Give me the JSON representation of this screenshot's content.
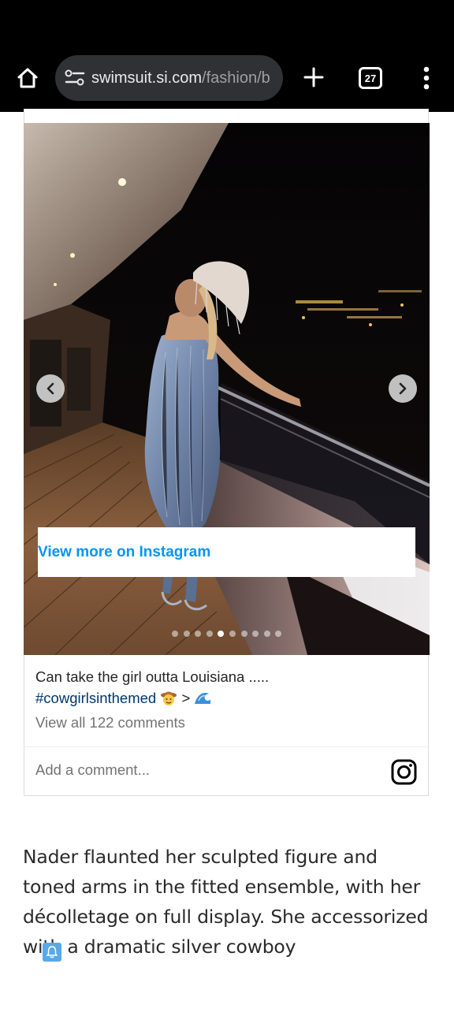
{
  "browser": {
    "url_host": "swimsuit.si.com",
    "url_path": "/fashion/b",
    "tab_count": "27",
    "home_icon": "home-icon",
    "site_settings_icon": "tune-icon",
    "new_tab_icon": "plus-icon",
    "menu_icon": "more-vert-icon"
  },
  "instagram": {
    "view_more": "View more on Instagram",
    "caption_text": "Can take the girl outta Louisiana .....",
    "hashtag": "#cowgirlsinthemed",
    "caption_arrow": ">",
    "view_comments": "View all 122 comments",
    "comment_placeholder": "Add a comment...",
    "carousel": {
      "total": 10,
      "active": 5
    },
    "accent_color": "#0095f6"
  },
  "article": {
    "paragraph": "Nader flaunted her sculpted figure and toned arms in the fitted ensemble, with her décolletage on full display. She accessorized with a dramatic silver cowboy"
  }
}
